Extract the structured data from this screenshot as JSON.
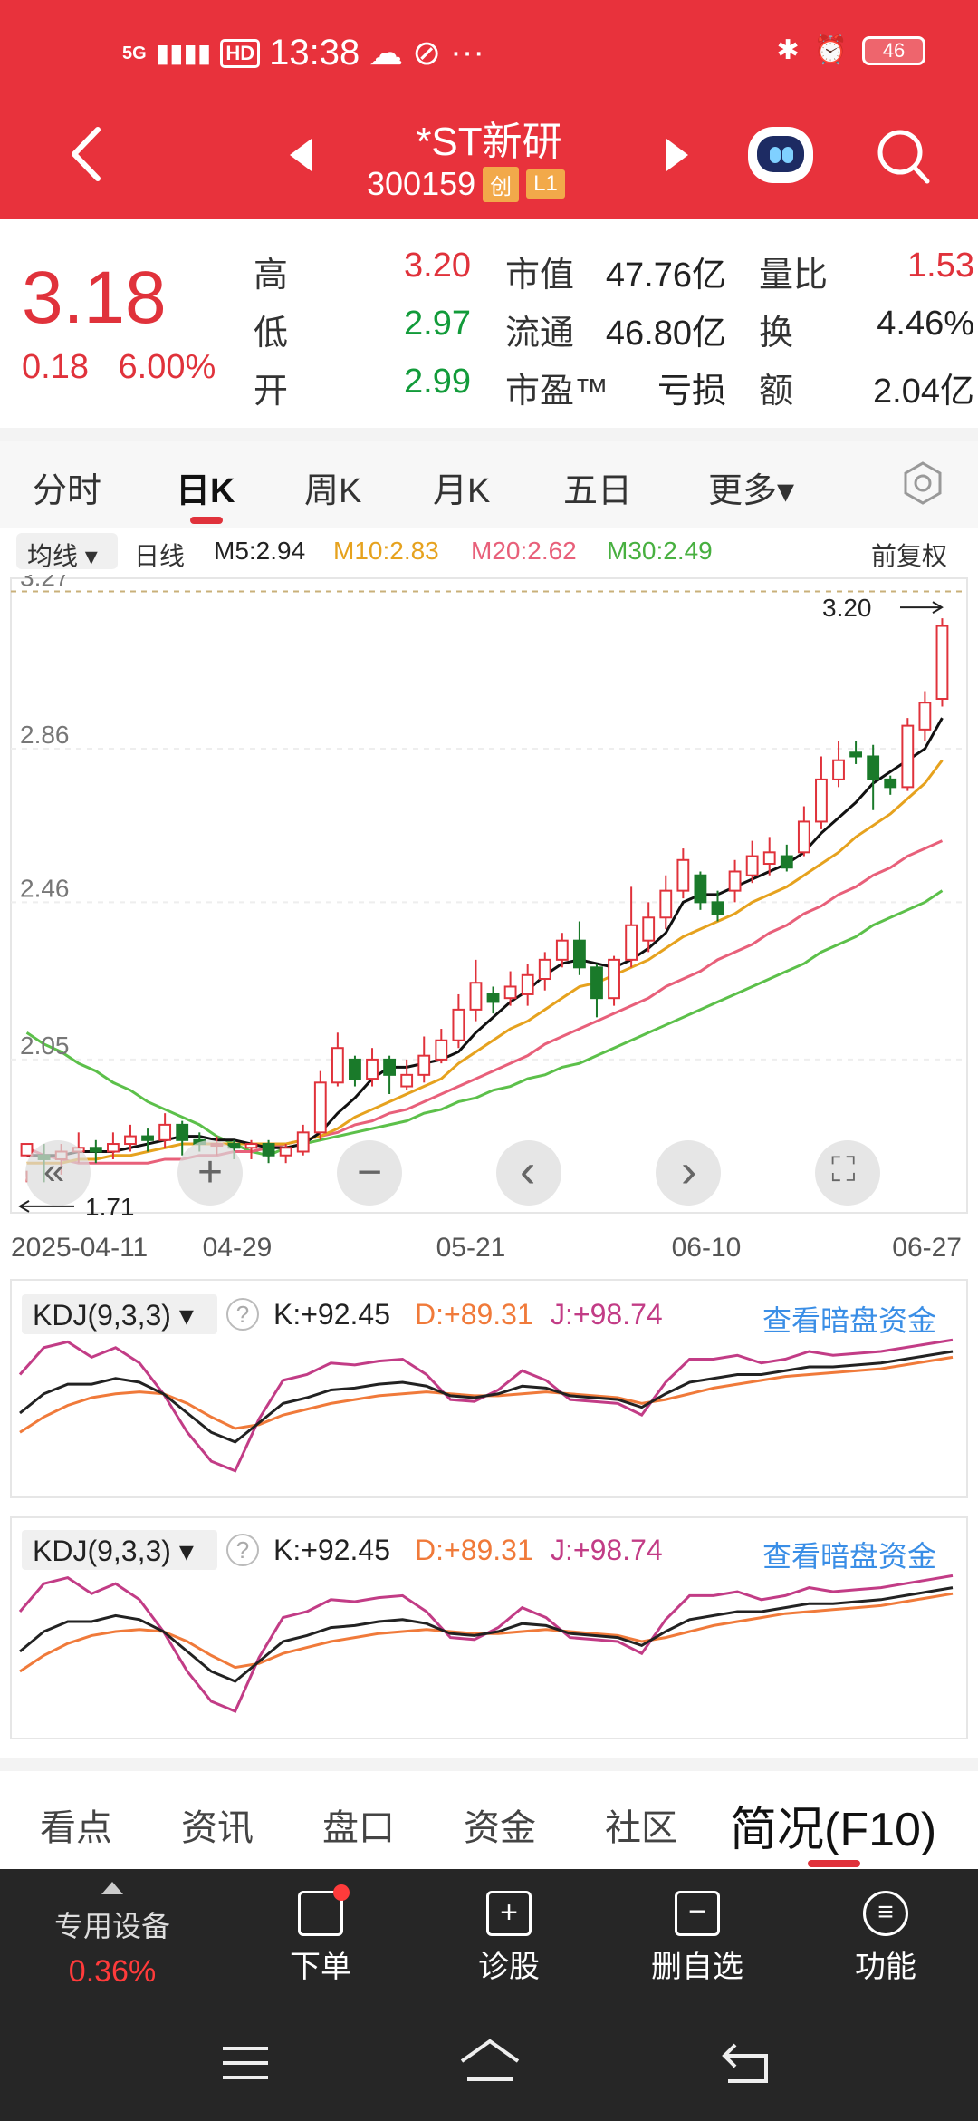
{
  "status_bar": {
    "network": "5G",
    "hd": "HD",
    "time": "13:38",
    "more": "···",
    "battery": "46"
  },
  "header": {
    "title": "*ST新研",
    "code": "300159",
    "tag1": "创",
    "tag2": "L1"
  },
  "quote": {
    "price": "3.18",
    "change": "0.18",
    "change_pct": "6.00%",
    "high_label": "高",
    "high": "3.20",
    "low_label": "低",
    "low": "2.97",
    "open_label": "开",
    "open": "2.99",
    "mktcap_label": "市值",
    "mktcap": "47.76亿",
    "float_label": "流通",
    "float": "46.80亿",
    "pe_label": "市盈™",
    "pe": "亏损",
    "vol_ratio_label": "量比",
    "vol_ratio": "1.53",
    "turnover_label": "换",
    "turnover": "4.46%",
    "amount_label": "额",
    "amount": "2.04亿"
  },
  "tabs": [
    "分时",
    "日K",
    "周K",
    "月K",
    "五日",
    "更多▾"
  ],
  "ma": {
    "selector": "均线 ▾",
    "line": "日线",
    "m5": "M5:2.94",
    "m10": "M10:2.83",
    "m20": "M20:2.62",
    "m30": "M30:2.49",
    "adjust": "前复权"
  },
  "colors": {
    "brand": "#e8323c",
    "up": "#e0323b",
    "down": "#1a7a2a",
    "ma5": "#111111",
    "ma10": "#e6a21e",
    "ma20": "#e8607a",
    "ma30": "#5cc04a",
    "k": "#222222",
    "d": "#f07a3a",
    "j": "#c23c86"
  },
  "chart_data": {
    "type": "candlestick",
    "y_ticks": [
      "3.27",
      "2.86",
      "2.46",
      "2.05"
    ],
    "x_ticks": [
      "2025-04-11",
      "04-29",
      "05-21",
      "06-10",
      "06-27"
    ],
    "max_label": "3.20",
    "min_label": "1.71",
    "ylim": [
      1.66,
      3.29
    ],
    "candles": [
      [
        1.8,
        1.83,
        1.76,
        1.73
      ],
      [
        1.8,
        1.79,
        1.83,
        1.73
      ],
      [
        1.79,
        1.81,
        1.83,
        1.75
      ],
      [
        1.81,
        1.82,
        1.86,
        1.78
      ],
      [
        1.82,
        1.81,
        1.84,
        1.78
      ],
      [
        1.81,
        1.83,
        1.86,
        1.79
      ],
      [
        1.83,
        1.85,
        1.88,
        1.81
      ],
      [
        1.85,
        1.84,
        1.87,
        1.81
      ],
      [
        1.84,
        1.88,
        1.91,
        1.82
      ],
      [
        1.88,
        1.84,
        1.89,
        1.8
      ],
      [
        1.84,
        1.83,
        1.86,
        1.81
      ],
      [
        1.83,
        1.83,
        1.85,
        1.8
      ],
      [
        1.83,
        1.82,
        1.84,
        1.79
      ],
      [
        1.82,
        1.83,
        1.84,
        1.79
      ],
      [
        1.83,
        1.8,
        1.84,
        1.78
      ],
      [
        1.8,
        1.82,
        1.83,
        1.78
      ],
      [
        1.81,
        1.86,
        1.88,
        1.8
      ],
      [
        1.86,
        1.99,
        2.02,
        1.84
      ],
      [
        1.99,
        2.08,
        2.12,
        1.98
      ],
      [
        2.05,
        2.0,
        2.06,
        1.98
      ],
      [
        2.0,
        2.05,
        2.08,
        1.98
      ],
      [
        2.05,
        2.01,
        2.06,
        1.96
      ],
      [
        1.98,
        2.01,
        2.05,
        1.97
      ],
      [
        2.01,
        2.06,
        2.11,
        1.99
      ],
      [
        2.05,
        2.1,
        2.13,
        2.04
      ],
      [
        2.1,
        2.18,
        2.22,
        2.08
      ],
      [
        2.18,
        2.25,
        2.31,
        2.15
      ],
      [
        2.22,
        2.2,
        2.24,
        2.17
      ],
      [
        2.21,
        2.24,
        2.28,
        2.19
      ],
      [
        2.22,
        2.27,
        2.3,
        2.19
      ],
      [
        2.26,
        2.31,
        2.33,
        2.23
      ],
      [
        2.31,
        2.36,
        2.38,
        2.29
      ],
      [
        2.36,
        2.29,
        2.41,
        2.27
      ],
      [
        2.29,
        2.21,
        2.3,
        2.16
      ],
      [
        2.21,
        2.31,
        2.32,
        2.19
      ],
      [
        2.31,
        2.4,
        2.5,
        2.29
      ],
      [
        2.36,
        2.42,
        2.46,
        2.33
      ],
      [
        2.42,
        2.49,
        2.53,
        2.39
      ],
      [
        2.49,
        2.57,
        2.6,
        2.47
      ],
      [
        2.53,
        2.46,
        2.54,
        2.44
      ],
      [
        2.46,
        2.43,
        2.49,
        2.41
      ],
      [
        2.49,
        2.54,
        2.57,
        2.46
      ],
      [
        2.53,
        2.58,
        2.62,
        2.51
      ],
      [
        2.56,
        2.59,
        2.63,
        2.53
      ],
      [
        2.58,
        2.55,
        2.61,
        2.54
      ],
      [
        2.59,
        2.67,
        2.71,
        2.58
      ],
      [
        2.67,
        2.78,
        2.84,
        2.65
      ],
      [
        2.78,
        2.83,
        2.88,
        2.76
      ],
      [
        2.85,
        2.84,
        2.88,
        2.82
      ],
      [
        2.84,
        2.78,
        2.87,
        2.7
      ],
      [
        2.78,
        2.76,
        2.79,
        2.74
      ],
      [
        2.76,
        2.92,
        2.94,
        2.75
      ],
      [
        2.91,
        2.98,
        3.01,
        2.88
      ],
      [
        2.99,
        3.18,
        3.2,
        2.97
      ]
    ],
    "ma5": [
      1.8,
      1.8,
      1.8,
      1.81,
      1.81,
      1.81,
      1.82,
      1.83,
      1.84,
      1.85,
      1.85,
      1.84,
      1.84,
      1.83,
      1.82,
      1.82,
      1.83,
      1.86,
      1.91,
      1.95,
      2.0,
      2.03,
      2.03,
      2.04,
      2.05,
      2.07,
      2.12,
      2.16,
      2.2,
      2.23,
      2.27,
      2.3,
      2.31,
      2.3,
      2.29,
      2.31,
      2.34,
      2.38,
      2.46,
      2.48,
      2.48,
      2.5,
      2.52,
      2.54,
      2.56,
      2.59,
      2.64,
      2.68,
      2.72,
      2.77,
      2.8,
      2.83,
      2.86,
      2.94
    ],
    "ma10": [
      1.78,
      1.78,
      1.78,
      1.79,
      1.79,
      1.8,
      1.8,
      1.81,
      1.82,
      1.83,
      1.83,
      1.83,
      1.83,
      1.83,
      1.83,
      1.83,
      1.84,
      1.85,
      1.87,
      1.9,
      1.92,
      1.94,
      1.96,
      1.98,
      2.0,
      2.04,
      2.07,
      2.1,
      2.13,
      2.15,
      2.18,
      2.21,
      2.24,
      2.25,
      2.27,
      2.29,
      2.31,
      2.34,
      2.37,
      2.39,
      2.41,
      2.43,
      2.46,
      2.48,
      2.5,
      2.53,
      2.56,
      2.59,
      2.63,
      2.66,
      2.69,
      2.73,
      2.77,
      2.83
    ],
    "ma20": [
      1.82,
      1.8,
      1.79,
      1.78,
      1.78,
      1.78,
      1.78,
      1.78,
      1.79,
      1.79,
      1.8,
      1.8,
      1.81,
      1.81,
      1.82,
      1.83,
      1.84,
      1.85,
      1.86,
      1.88,
      1.89,
      1.91,
      1.92,
      1.94,
      1.96,
      1.98,
      2.0,
      2.02,
      2.04,
      2.06,
      2.09,
      2.11,
      2.13,
      2.15,
      2.17,
      2.19,
      2.21,
      2.24,
      2.26,
      2.28,
      2.31,
      2.33,
      2.35,
      2.38,
      2.4,
      2.43,
      2.45,
      2.48,
      2.5,
      2.53,
      2.55,
      2.58,
      2.6,
      2.62
    ],
    "ma30": [
      2.12,
      2.09,
      2.07,
      2.04,
      2.02,
      1.99,
      1.97,
      1.94,
      1.92,
      1.9,
      1.88,
      1.85,
      1.83,
      1.81,
      1.8,
      1.82,
      1.83,
      1.84,
      1.85,
      1.86,
      1.87,
      1.88,
      1.89,
      1.91,
      1.92,
      1.94,
      1.95,
      1.97,
      1.98,
      2.0,
      2.01,
      2.03,
      2.04,
      2.06,
      2.08,
      2.1,
      2.12,
      2.14,
      2.16,
      2.18,
      2.2,
      2.22,
      2.24,
      2.26,
      2.28,
      2.3,
      2.33,
      2.35,
      2.37,
      2.4,
      2.42,
      2.44,
      2.46,
      2.49
    ]
  },
  "kdj": {
    "selector": "KDJ(9,3,3) ▾",
    "help": "?",
    "k": "K:+92.45",
    "d": "D:+89.31",
    "j": "J:+98.74",
    "link": "查看暗盘资金",
    "k_values": [
      60,
      70,
      75,
      75,
      78,
      76,
      70,
      60,
      50,
      45,
      55,
      65,
      68,
      72,
      73,
      75,
      76,
      74,
      69,
      68,
      70,
      74,
      73,
      69,
      68,
      67,
      63,
      70,
      76,
      78,
      80,
      80,
      82,
      84,
      84,
      85,
      86,
      88,
      90,
      92
    ],
    "d_values": [
      50,
      58,
      64,
      68,
      70,
      71,
      70,
      65,
      58,
      52,
      54,
      59,
      62,
      65,
      67,
      69,
      70,
      71,
      70,
      69,
      69,
      70,
      71,
      70,
      69,
      68,
      65,
      67,
      70,
      73,
      75,
      77,
      79,
      80,
      81,
      82,
      83,
      85,
      87,
      89
    ],
    "j_values": [
      80,
      94,
      97,
      89,
      94,
      86,
      70,
      50,
      35,
      30,
      57,
      77,
      80,
      86,
      85,
      87,
      88,
      80,
      67,
      66,
      72,
      82,
      77,
      67,
      66,
      65,
      59,
      76,
      88,
      88,
      90,
      86,
      88,
      92,
      90,
      91,
      92,
      94,
      96,
      98
    ]
  },
  "controls": {
    "prev": "«",
    "zoom_in": "+",
    "zoom_out": "−",
    "left": "‹",
    "right": "›",
    "fullscreen": "⛶"
  },
  "bottom_tabs": [
    "看点",
    "资讯",
    "盘口",
    "资金",
    "社区",
    "简况(F10)"
  ],
  "toolbar": {
    "device_label": "专用设备",
    "device_pct": "0.36%",
    "order": "下单",
    "diagnose": "诊股",
    "remove": "删自选",
    "function": "功能"
  }
}
